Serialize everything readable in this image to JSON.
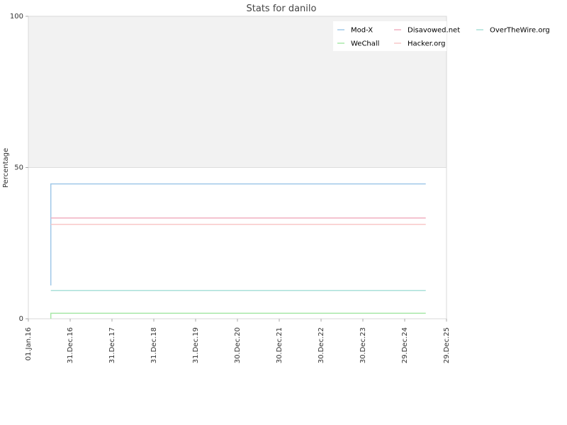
{
  "chart_data": {
    "type": "line",
    "title": "Stats for danilo",
    "xlabel": "",
    "ylabel": "Percentage",
    "ylim": [
      0,
      100
    ],
    "yticks": [
      0,
      50,
      100
    ],
    "xlim": [
      "2016-01-01",
      "2025-12-29"
    ],
    "xticks": [
      {
        "date": "2016-01-01",
        "label": "01.Jan.16"
      },
      {
        "date": "2016-12-31",
        "label": "31.Dec.16"
      },
      {
        "date": "2017-12-31",
        "label": "31.Dec.17"
      },
      {
        "date": "2018-12-31",
        "label": "31.Dec.18"
      },
      {
        "date": "2019-12-31",
        "label": "31.Dec.19"
      },
      {
        "date": "2020-12-30",
        "label": "30.Dec.20"
      },
      {
        "date": "2021-12-30",
        "label": "30.Dec.21"
      },
      {
        "date": "2022-12-30",
        "label": "30.Dec.22"
      },
      {
        "date": "2023-12-30",
        "label": "30.Dec.23"
      },
      {
        "date": "2024-12-29",
        "label": "29.Dec.24"
      },
      {
        "date": "2025-12-29",
        "label": "29.Dec.25"
      }
    ],
    "grid": true,
    "shaded_band": [
      50,
      100
    ],
    "legend_position": "top-right",
    "series": [
      {
        "name": "Mod-X",
        "color": "#a0c8e8",
        "points": [
          {
            "x": "2016-07-15",
            "y": 11
          },
          {
            "x": "2016-07-15",
            "y": 44.6
          },
          {
            "x": "2025-07-01",
            "y": 44.6
          }
        ]
      },
      {
        "name": "WeChall",
        "color": "#a8e8a8",
        "points": [
          {
            "x": "2016-07-15",
            "y": 0
          },
          {
            "x": "2016-07-15",
            "y": 1.8
          },
          {
            "x": "2025-07-01",
            "y": 1.8
          }
        ]
      },
      {
        "name": "Disavowed.net",
        "color": "#f0b0c0",
        "points": [
          {
            "x": "2016-07-15",
            "y": 33.3
          },
          {
            "x": "2025-07-01",
            "y": 33.3
          }
        ]
      },
      {
        "name": "Hacker.org",
        "color": "#f8c8c8",
        "points": [
          {
            "x": "2016-07-15",
            "y": 31.2
          },
          {
            "x": "2025-07-01",
            "y": 31.2
          }
        ]
      },
      {
        "name": "OverTheWire.org",
        "color": "#a8e0d8",
        "points": [
          {
            "x": "2016-07-15",
            "y": 9.3
          },
          {
            "x": "2025-07-01",
            "y": 9.3
          }
        ]
      }
    ],
    "legend_order": [
      "Mod-X",
      "Disavowed.net",
      "OverTheWire.org",
      "WeChall",
      "Hacker.org"
    ]
  }
}
